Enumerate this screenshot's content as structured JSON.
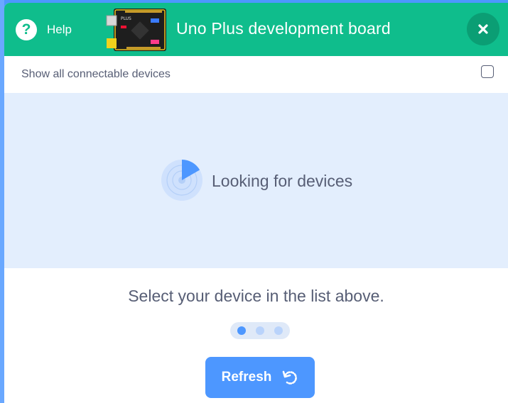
{
  "header": {
    "help_label": "Help",
    "title": "Uno Plus development board",
    "close_icon": "close-icon"
  },
  "options": {
    "show_all_label": "Show all connectable devices",
    "show_all_checked": false
  },
  "scan": {
    "status_text": "Looking for devices",
    "icon": "radar-scan-icon"
  },
  "footer": {
    "instruction": "Select your device in the list above.",
    "step_current": 1,
    "step_total": 3,
    "refresh_label": "Refresh",
    "refresh_icon": "refresh-icon"
  },
  "colors": {
    "header_bg": "#0fbd8c",
    "accent": "#4d97ff",
    "scan_bg": "#e3eefd",
    "text": "#575e75"
  }
}
